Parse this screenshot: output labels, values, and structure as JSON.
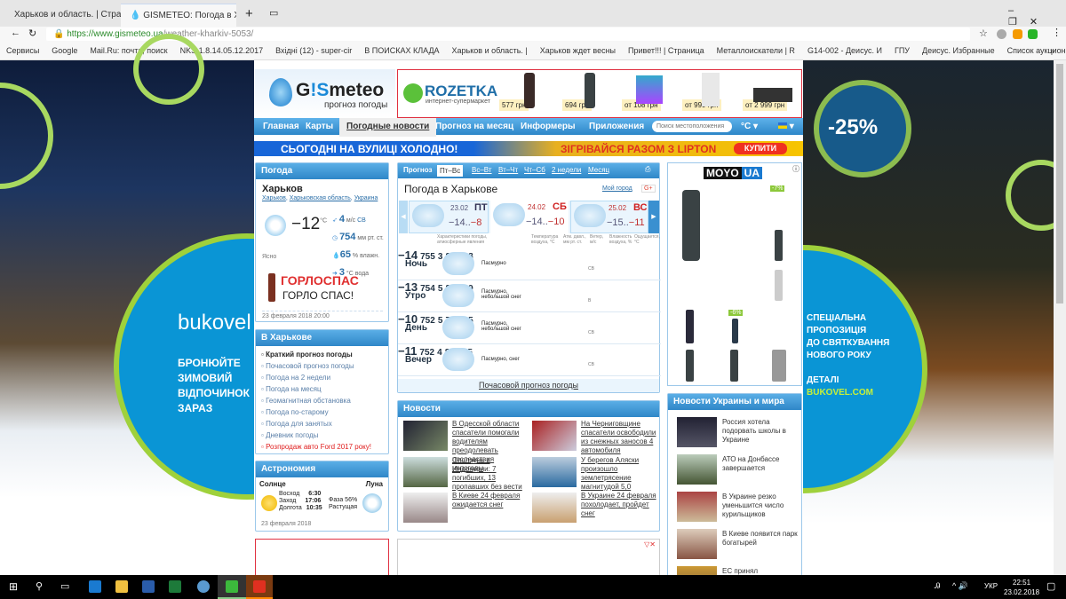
{
  "browser": {
    "tabs": [
      "Харьков и область. | Страница",
      "GISMETEO: Погода в Харькове"
    ],
    "url_host": "https://www.gismeteo.ua",
    "url_path": "/weather-kharkiv-5053/",
    "bookmarks": [
      "Сервисы",
      "Google",
      "Mail.Ru: почта, поиск",
      "NKS 1.8.14.05.12.2017",
      "Вхідні (12) - super-cir",
      "В ПОИСКАХ КЛАДА",
      "Харьков и область. |",
      "Харьков ждет весны",
      "Привет!!! | Страница",
      "Металлоискатели | R",
      "G14-002 - Деисус. И",
      "ГПУ",
      "Деисус. Избранные",
      "Список аукционов -",
      "»"
    ]
  },
  "logo": {
    "name": "GISMETEO",
    "tagline": "прогноз погоды"
  },
  "rozetka": {
    "brand": "ROZETKA",
    "tagline": "интернет-супермаркет",
    "prices": [
      "577 грн",
      "694 грн",
      "от 108 грн",
      "от 999 грн",
      "от 2 999 грн"
    ]
  },
  "nav": {
    "items": [
      "Главная",
      "Карты",
      "Погодные новости",
      "Прогноз на месяц",
      "Информеры",
      "Приложения"
    ],
    "search_placeholder": "Поиск местоположения",
    "units": "°C ▾",
    "lang": "▾"
  },
  "lipton": {
    "left": "СЬОГОДНІ НА ВУЛИЦІ ХОЛОДНО!",
    "right": "ЗІГРІВАЙСЯ РАЗОМ З LIPTON",
    "button": "КУПИТИ"
  },
  "weather": {
    "title": "Погода",
    "city": "Харьков",
    "crumbs": [
      "Харьков",
      "Харьковская область",
      "Украина"
    ],
    "temp": "−12",
    "temp_unit": "°C",
    "condition": "Ясно",
    "wind": "4",
    "wind_unit": "м/с",
    "wind_dir": "СВ",
    "pressure": "754",
    "pressure_unit": "мм рт. ст.",
    "humidity": "65",
    "humidity_unit": "% влажн.",
    "water": "3",
    "water_unit": "°C вода",
    "ad_brand": "ГОРЛОСПАС",
    "ad_slogan": "ГОРЛО СПАС!",
    "date": "23 февраля 2018 20:00"
  },
  "city_links": {
    "title": "В Харькове",
    "items": [
      "Краткий прогноз погоды",
      "Почасовой прогноз погоды",
      "Погода на 2 недели",
      "Погода на месяц",
      "Геомагнитная обстановка",
      "Погода по-старому",
      "Погода для занятых",
      "Дневник погоды"
    ],
    "promo": "Розпродаж авто Ford 2017 року!"
  },
  "astro": {
    "title": "Астрономия",
    "sun": "Солнце",
    "moon": "Луна",
    "rise_label": "Восход",
    "rise": "6:30",
    "set_label": "Заход",
    "set": "17:06",
    "len_label": "Долгота",
    "len": "10:35",
    "phase": "Фаза 56%",
    "phase_state": "Растущая",
    "date": "23 февраля 2018"
  },
  "forecast": {
    "tabs": [
      "Прогноз",
      "Пт–Вс",
      "Вс–Вт",
      "Вт–Чт",
      "Чт–Сб",
      "2 недели",
      "Месяц"
    ],
    "title": "Погода в Харькове",
    "my_city": "Мой город",
    "gplus": "G+",
    "days": [
      {
        "date": "23.02",
        "dow": "ПТ",
        "min": "−14..",
        "max": "−8"
      },
      {
        "date": "24.02",
        "dow": "СБ",
        "min": "−14..",
        "max": "−10"
      },
      {
        "date": "25.02",
        "dow": "ВС",
        "min": "−15..",
        "max": "−11"
      }
    ],
    "headers": [
      "Характеристики погоды, атмосферные явления",
      "Температура воздуха, °C",
      "Атм. давл., мм рт. ст.",
      "Ветер, м/с",
      "Влажность воздуха, %",
      "Ощущается, °C"
    ],
    "rows": [
      {
        "part": "Ночь",
        "desc": "Пасмурно",
        "t": "−14",
        "p": "755",
        "wd": "СВ",
        "w": "3",
        "h": "82",
        "f": "−18"
      },
      {
        "part": "Утро",
        "desc": "Пасмурно, небольшой снег",
        "t": "−13",
        "p": "754",
        "wd": "В",
        "w": "5",
        "h": "81",
        "f": "−19"
      },
      {
        "part": "День",
        "desc": "Пасмурно, небольшой снег",
        "t": "−10",
        "p": "752",
        "wd": "СВ",
        "w": "5",
        "h": "76",
        "f": "−15"
      },
      {
        "part": "Вечер",
        "desc": "Пасмурно, снег",
        "t": "−11",
        "p": "752",
        "wd": "СВ",
        "w": "4",
        "h": "83",
        "f": "−15"
      }
    ],
    "hourly_link": "Почасовой прогноз погоды"
  },
  "news": {
    "title": "Новости",
    "items": [
      "В Одесской области спасатели помогали водителям преодолевать последствия непогоды",
      "На Черниговщине спасатели освободили из снежных заносов 4 автомобиля",
      "Оползень в Индонезии: 7 погибших, 13 пропавших без вести",
      "У берегов Аляски произошло землетрясение магнитудой 5,0",
      "В Киеве 24 февраля ожидается снег",
      "В Украине 24 февраля похолодает, пройдет снег"
    ]
  },
  "moyo": {
    "brand_a": "MOYO",
    "brand_b": "UA",
    "badges": [
      "-7%",
      "-6%"
    ]
  },
  "world_news": {
    "title": "Новости Украины и мира",
    "items": [
      "Россия хотела подорвать школы в Украине",
      "АТО на Донбассе завершается",
      "В Украине резко уменьшится число курильщиков",
      "В Киеве появится парк богатырей",
      "ЕС принял шокирующее для Украины решение"
    ]
  },
  "left_ad": {
    "brand": "bukovel",
    "text": [
      "БРОНЮЙТЕ",
      "ЗИМОВИЙ",
      "ВІДПОЧИНОК",
      "ЗАРАЗ"
    ]
  },
  "right_ad": {
    "discount": "-25%",
    "text": [
      "СПЕЦІАЛЬНА",
      "ПРОПОЗИЦІЯ",
      "ДО СВЯТКУВАННЯ",
      "НОВОГО РОКУ"
    ],
    "details": "ДЕТАЛІ",
    "site": "BUKOVEL.COM"
  },
  "taskbar": {
    "lang": "УКР",
    "time": "22:51",
    "date": "23.02.2018"
  }
}
